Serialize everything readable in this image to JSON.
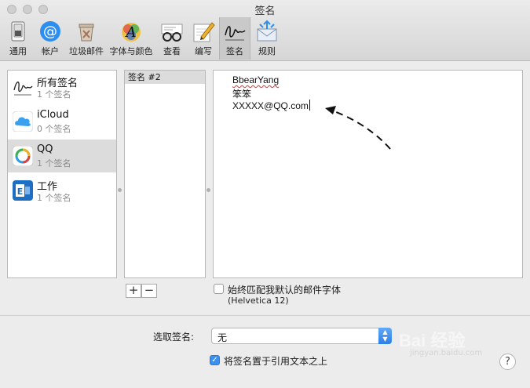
{
  "window": {
    "title": "签名"
  },
  "toolbar": {
    "items": [
      {
        "label": "通用",
        "icon": "general-switch-icon"
      },
      {
        "label": "帐户",
        "icon": "at-sign-icon"
      },
      {
        "label": "垃圾邮件",
        "icon": "trash-bin-icon"
      },
      {
        "label": "字体与颜色",
        "icon": "font-color-icon"
      },
      {
        "label": "查看",
        "icon": "glasses-icon"
      },
      {
        "label": "编写",
        "icon": "pencil-paper-icon"
      },
      {
        "label": "签名",
        "icon": "signature-icon"
      },
      {
        "label": "规则",
        "icon": "rules-envelope-icon"
      }
    ],
    "active": "签名"
  },
  "accounts": [
    {
      "name": "所有签名",
      "sub": "1 个签名"
    },
    {
      "name": "iCloud",
      "sub": "0 个签名"
    },
    {
      "name": "QQ",
      "sub": "1 个签名"
    },
    {
      "name": "工作",
      "sub": "1 个签名"
    }
  ],
  "signatures": {
    "items": [
      "签名 #2"
    ]
  },
  "editor": {
    "lines": [
      "BbearYang",
      "笨笨",
      "XXXXX@QQ.com"
    ]
  },
  "buttons": {
    "add": "+",
    "remove": "−"
  },
  "font_option": {
    "label": "始终匹配我默认的邮件字体",
    "font": "(Helvetica 12)",
    "checked": false
  },
  "choose": {
    "label": "选取签名:",
    "value": "无"
  },
  "place_option": {
    "label": "将签名置于引用文本之上",
    "checked": true
  },
  "help": {
    "label": "?"
  },
  "watermark": {
    "text": "Bai 经验",
    "sub": "jingyan.baidu.com"
  },
  "colors": {
    "selection": "#dcdcdc",
    "accent": "#3b8ff0"
  }
}
